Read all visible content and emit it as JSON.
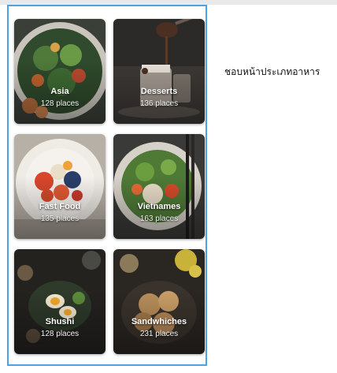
{
  "side_label": "ชอบหน้าประเภทอาหาร",
  "categories": [
    {
      "name": "Asia",
      "count": "128 places"
    },
    {
      "name": "Desserts",
      "count": "136 places"
    },
    {
      "name": "Fast Food",
      "count": "135 places"
    },
    {
      "name": "Vietnames",
      "count": "163 places"
    },
    {
      "name": "Shushi",
      "count": "128 places"
    },
    {
      "name": "Sandwhiches",
      "count": "231 places"
    }
  ],
  "colors": {
    "frame_border": "#4aa3e6",
    "top_strip": "#e9e9e9"
  }
}
